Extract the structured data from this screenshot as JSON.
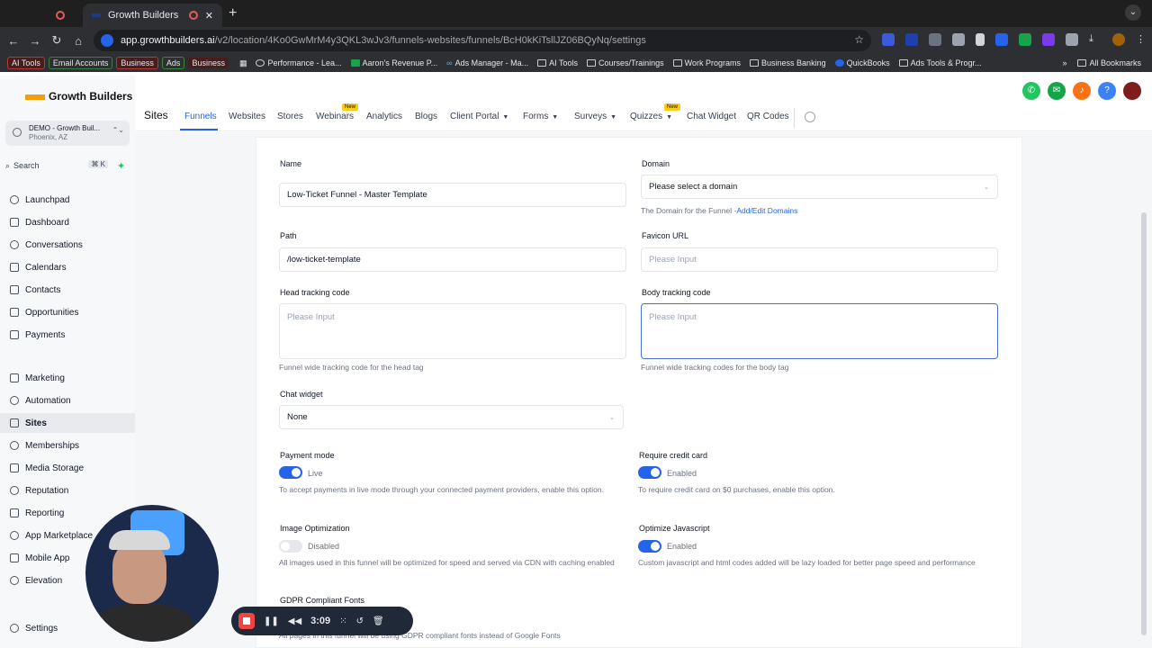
{
  "browser": {
    "active_tab_title": "Growth Builders",
    "url_host": "app.growthbuilders.ai",
    "url_path": "/v2/location/4Ko0GwMrM4y3QKL3wJv3/funnels-websites/funnels/BcH0kKiTsllJZ06BQyNq/settings",
    "bookmarks": [
      "AI Tools",
      "Email Accounts",
      "Business",
      "Ads",
      "Business",
      "Performance - Lea...",
      "Aaron's Revenue P...",
      "Ads Manager - Ma...",
      "AI Tools",
      "Courses/Trainings",
      "Work Programs",
      "Business Banking",
      "QuickBooks",
      "Ads Tools & Progr..."
    ],
    "all_bookmarks": "All Bookmarks"
  },
  "app": {
    "logo_text": "Growth Builders",
    "account_name": "DEMO - Growth Buil...",
    "account_location": "Phoenix, AZ",
    "search_label": "Search",
    "search_shortcut": "⌘ K"
  },
  "sidebar": {
    "items": [
      "Launchpad",
      "Dashboard",
      "Conversations",
      "Calendars",
      "Contacts",
      "Opportunities",
      "Payments",
      "Marketing",
      "Automation",
      "Sites",
      "Memberships",
      "Media Storage",
      "Reputation",
      "Reporting",
      "App Marketplace",
      "Mobile App",
      "Elevation",
      "Settings"
    ],
    "active": "Sites"
  },
  "topnav": {
    "section": "Sites",
    "tabs": [
      "Funnels",
      "Websites",
      "Stores",
      "Webinars",
      "Analytics",
      "Blogs",
      "Client Portal",
      "Forms",
      "Surveys",
      "Quizzes",
      "Chat Widget",
      "QR Codes"
    ],
    "new_badge": "New"
  },
  "form": {
    "name_label": "Name",
    "name_value": "Low-Ticket Funnel - Master Template",
    "domain_label": "Domain",
    "domain_placeholder": "Please select a domain",
    "domain_help": "The Domain for the Funnel -",
    "domain_help_link": "Add/Edit Domains",
    "path_label": "Path",
    "path_value": "/low-ticket-template",
    "favicon_label": "Favicon URL",
    "favicon_placeholder": "Please Input",
    "head_label": "Head tracking code",
    "head_placeholder": "Please Input",
    "head_help": "Funnel wide tracking code for the head tag",
    "body_label": "Body tracking code",
    "body_placeholder": "Please Input",
    "body_help": "Funnel wide tracking codes for the body tag",
    "chat_label": "Chat widget",
    "chat_value": "None",
    "payment_label": "Payment mode",
    "payment_state": "Live",
    "payment_desc": "To accept payments in live mode through your connected payment providers, enable this option.",
    "credit_label": "Require credit card",
    "credit_state": "Enabled",
    "credit_desc": "To require credit card on $0 purchases, enable this option.",
    "imgopt_label": "Image Optimization",
    "imgopt_state": "Disabled",
    "imgopt_desc": "All images used in this funnel will be optimized for speed and served via CDN with caching enabled",
    "js_label": "Optimize Javascript",
    "js_state": "Enabled",
    "js_desc": "Custom javascript and html codes added will be lazy loaded for better page speed and performance",
    "gdpr_label": "GDPR Compliant Fonts",
    "gdpr_desc": "All pages in this funnel will be using GDPR compliant fonts instead of Google Fonts"
  },
  "recorder": {
    "time": "3:09"
  }
}
